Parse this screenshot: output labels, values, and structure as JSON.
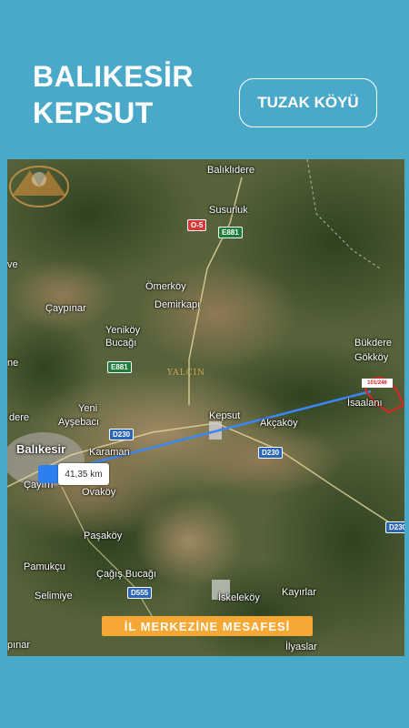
{
  "header": {
    "title_line1": "BALIKESİR",
    "title_line2": "KEPSUT",
    "tag_button": "TUZAK KÖYÜ"
  },
  "map": {
    "places": {
      "balikliдere": "Balıklıdere",
      "susurluk": "Susurluk",
      "omerkoy": "Ömerköy",
      "demirkapi": "Demirkapı",
      "caypinar": "Çaypınar",
      "yenikoy": "Yeniköy",
      "bucagi": "Bucağı",
      "yeni": "Yeni",
      "aysebaci": "Ayşebacı",
      "dere": "dere",
      "balikesir": "Balıkesir",
      "cayirh": "Çayırh",
      "karaman": "Karaman",
      "ovakoy": "Ovaköy",
      "kepsut": "Kepsut",
      "akcakoy": "Akçaköy",
      "bukdere": "Bükdere",
      "gokkoy": "Gökköy",
      "isaalani": "İsaalanı",
      "pasakoy": "Paşaköy",
      "pamukcu": "Pamukçu",
      "cagis_bucagi": "Çağış Bucağı",
      "selimiye": "Selimiye",
      "iskelekoy": "İskeleköy",
      "kayirlar": "Kayırlar",
      "ilyaslar": "İlyaslar",
      "pinar": "pınar",
      "edge_ve": "ve",
      "edge_ne": "ne"
    },
    "roads": {
      "o5": "O-5",
      "e881_top": "E881",
      "e881_mid": "E881",
      "d230_left": "D230",
      "d230_mid": "D230",
      "d230_right": "D230",
      "d555": "D555"
    },
    "distance_label": "41,35 km",
    "parcel_tag": "101/246",
    "watermark_text": "YALÇIN",
    "caption": "İL MERKEZİNE MESAFESİ",
    "route_color": "#3b86f2",
    "parcel_color": "#e02424"
  }
}
